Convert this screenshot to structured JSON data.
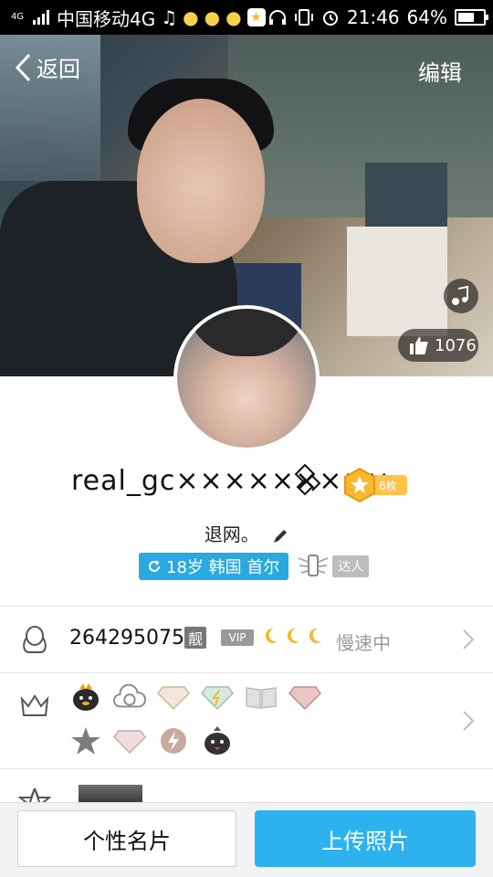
{
  "status_bar": {
    "signal_label": "4G",
    "carrier": "中国移动4G",
    "time": "21:46",
    "battery": "64%",
    "battery_level": 0.64
  },
  "header": {
    "back_label": "返回",
    "edit_label": "编辑"
  },
  "cover": {
    "like_count": "1076"
  },
  "profile": {
    "nickname": "real_gc×××××××××",
    "vip_badge_text": "6枚",
    "signature": "退网。",
    "location_tag": "18岁 韩国 首尔",
    "daren_label": "达人"
  },
  "info_rows": {
    "qq_number": "2642950756",
    "liang_badge": "靓",
    "vip_badge": "VIP",
    "speed_status": "慢速中"
  },
  "icons": {
    "back": "chevron-left-icon",
    "music": "music-note-icon",
    "like": "thumbs-up-icon",
    "qq": "qq-penguin-icon",
    "crown": "crown-icon",
    "star": "star-icon",
    "chevron": "chevron-right-icon"
  },
  "colors": {
    "accent": "#2db2ef",
    "tag_blue": "#2aa9e0",
    "vip_gold": "#ffc34a",
    "moon_gold": "#f5b82e"
  },
  "bottom_bar": {
    "card_label": "个性名片",
    "upload_label": "上传照片"
  }
}
